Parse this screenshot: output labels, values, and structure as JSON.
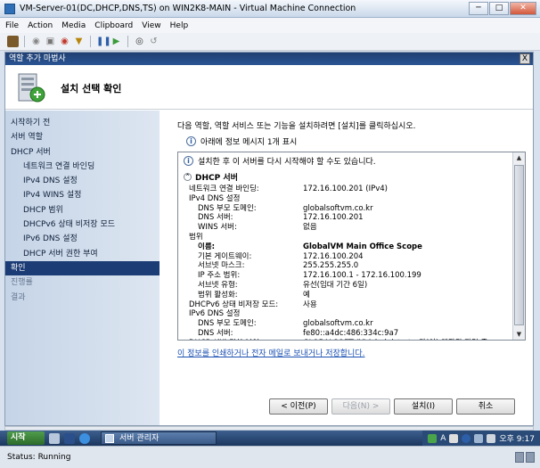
{
  "window": {
    "title": "VM-Server-01(DC,DHCP,DNS,TS) on WIN2K8-MAIN - Virtual Machine Connection",
    "minimize": "─",
    "maximize": "□",
    "close": "✕"
  },
  "menu": [
    "File",
    "Action",
    "Media",
    "Clipboard",
    "View",
    "Help"
  ],
  "wizard": {
    "title": "역할 추가 마법사",
    "close": "X",
    "header": "설치 선택 확인",
    "nav": [
      {
        "label": "시작하기 전",
        "level": 0,
        "state": "normal"
      },
      {
        "label": "서버 역할",
        "level": 0,
        "state": "normal"
      },
      {
        "label": "DHCP 서버",
        "level": 0,
        "state": "normal"
      },
      {
        "label": "네트워크 연결 바인딩",
        "level": 1,
        "state": "normal"
      },
      {
        "label": "IPv4 DNS 설정",
        "level": 1,
        "state": "normal"
      },
      {
        "label": "IPv4 WINS 설정",
        "level": 1,
        "state": "normal"
      },
      {
        "label": "DHCP 범위",
        "level": 1,
        "state": "normal"
      },
      {
        "label": "DHCPv6 상태 비저장 모드",
        "level": 1,
        "state": "normal"
      },
      {
        "label": "IPv6 DNS 설정",
        "level": 1,
        "state": "normal"
      },
      {
        "label": "DHCP 서버 권한 부여",
        "level": 1,
        "state": "normal"
      },
      {
        "label": "확인",
        "level": 0,
        "state": "active"
      },
      {
        "label": "진행률",
        "level": 0,
        "state": "dim"
      },
      {
        "label": "결과",
        "level": 0,
        "state": "dim"
      }
    ],
    "instruction": "다음 역할, 역할 서비스 또는 기능을 설치하려면 [설치]를 클릭하십시오.",
    "info_message": "아래에 정보 메시지 1개 표시",
    "details": {
      "warning": "설치한 후 이 서버를 다시 시작해야 할 수도 있습니다.",
      "section_title": "DHCP 서버",
      "rows": [
        {
          "label": "네트워크 연결 바인딩:",
          "value": "172.16.100.201 (IPv4)",
          "level": 0,
          "bold": false
        },
        {
          "label": "IPv4 DNS 설정",
          "value": "",
          "level": 0,
          "bold": false
        },
        {
          "label": "DNS 부모 도메인:",
          "value": "globalsoftvm.co.kr",
          "level": 1,
          "bold": false
        },
        {
          "label": "DNS 서버:",
          "value": "172.16.100.201",
          "level": 1,
          "bold": false
        },
        {
          "label": "WINS 서버:",
          "value": "없음",
          "level": 1,
          "bold": false
        },
        {
          "label": "범위",
          "value": "",
          "level": 0,
          "bold": false
        },
        {
          "label": "이름:",
          "value": "GlobalVM Main Office Scope",
          "level": 1,
          "bold": true
        },
        {
          "label": "기본 게이트웨이:",
          "value": "172.16.100.204",
          "level": 1,
          "bold": false
        },
        {
          "label": "서브넷 마스크:",
          "value": "255.255.255.0",
          "level": 1,
          "bold": false
        },
        {
          "label": "IP 주소 범위:",
          "value": "172.16.100.1 - 172.16.100.199",
          "level": 1,
          "bold": false
        },
        {
          "label": "서브넷 유형:",
          "value": "유선(임대 기간 6일)",
          "level": 1,
          "bold": false
        },
        {
          "label": "범위 활성화:",
          "value": "예",
          "level": 1,
          "bold": false
        },
        {
          "label": "DHCPv6 상태 비저장 모드:",
          "value": "사용",
          "level": 0,
          "bold": false
        },
        {
          "label": "IPv6 DNS 설정",
          "value": "",
          "level": 0,
          "bold": false
        },
        {
          "label": "DNS 부모 도메인:",
          "value": "globalsoftvm.co.kr",
          "level": 1,
          "bold": false
        },
        {
          "label": "DNS 서버:",
          "value": "fe80::a4dc:486:334c:9a7",
          "level": 1,
          "bold": false
        },
        {
          "label": "DHCP 서버 권한 부여:",
          "value": "GLOBALSOFTVM\\Administrator가(이) 액관된 자격 증",
          "level": 0,
          "bold": false
        }
      ]
    },
    "print_link": "이 정보를 인쇄하거나 전자 메일로 보내거나 저장합니다.",
    "buttons": {
      "prev": "< 이전(P)",
      "next": "다음(N) >",
      "install": "설치(I)",
      "cancel": "취소"
    }
  },
  "taskbar": {
    "start": "시작",
    "task": "서버 관리자",
    "lang": "A",
    "time": "오후 9:17"
  },
  "status": {
    "text": "Status: Running"
  },
  "colors": {
    "nav_active": "#1c3c76",
    "wizard_title": "#2a5494",
    "link": "#1a4fb2"
  }
}
